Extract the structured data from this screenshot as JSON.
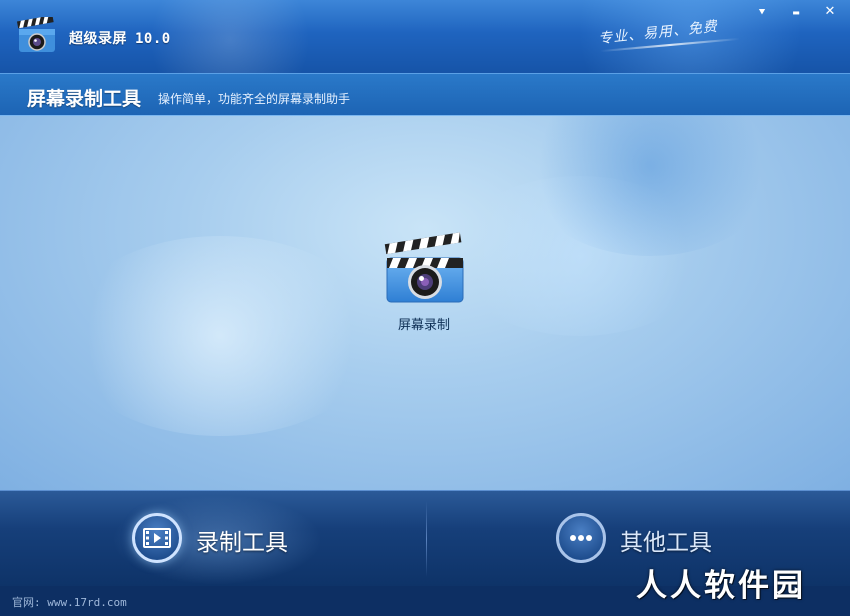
{
  "app": {
    "title": "超级录屏",
    "version": "10.0",
    "slogan": "专业、易用、免费"
  },
  "window_controls": {
    "menu_glyph": "⯆",
    "minimize_glyph": "▬",
    "close_glyph": "✕"
  },
  "subheader": {
    "title": "屏幕录制工具",
    "description": "操作简单，功能齐全的屏幕录制助手"
  },
  "tools": [
    {
      "label": "屏幕录制",
      "icon": "clapperboard-camera-icon"
    }
  ],
  "bottom_nav": {
    "tabs": [
      {
        "label": "录制工具",
        "icon": "film-icon",
        "active": true
      },
      {
        "label": "其他工具",
        "icon": "more-dots-icon",
        "active": false
      }
    ]
  },
  "footer": {
    "site_prefix": "官网:",
    "site_url": "www.17rd.com"
  },
  "watermark": "人人软件园",
  "colors": {
    "title_bar": "#1f64bf",
    "content_bg": "#a7cdee",
    "bottom_bar": "#163f7a"
  }
}
